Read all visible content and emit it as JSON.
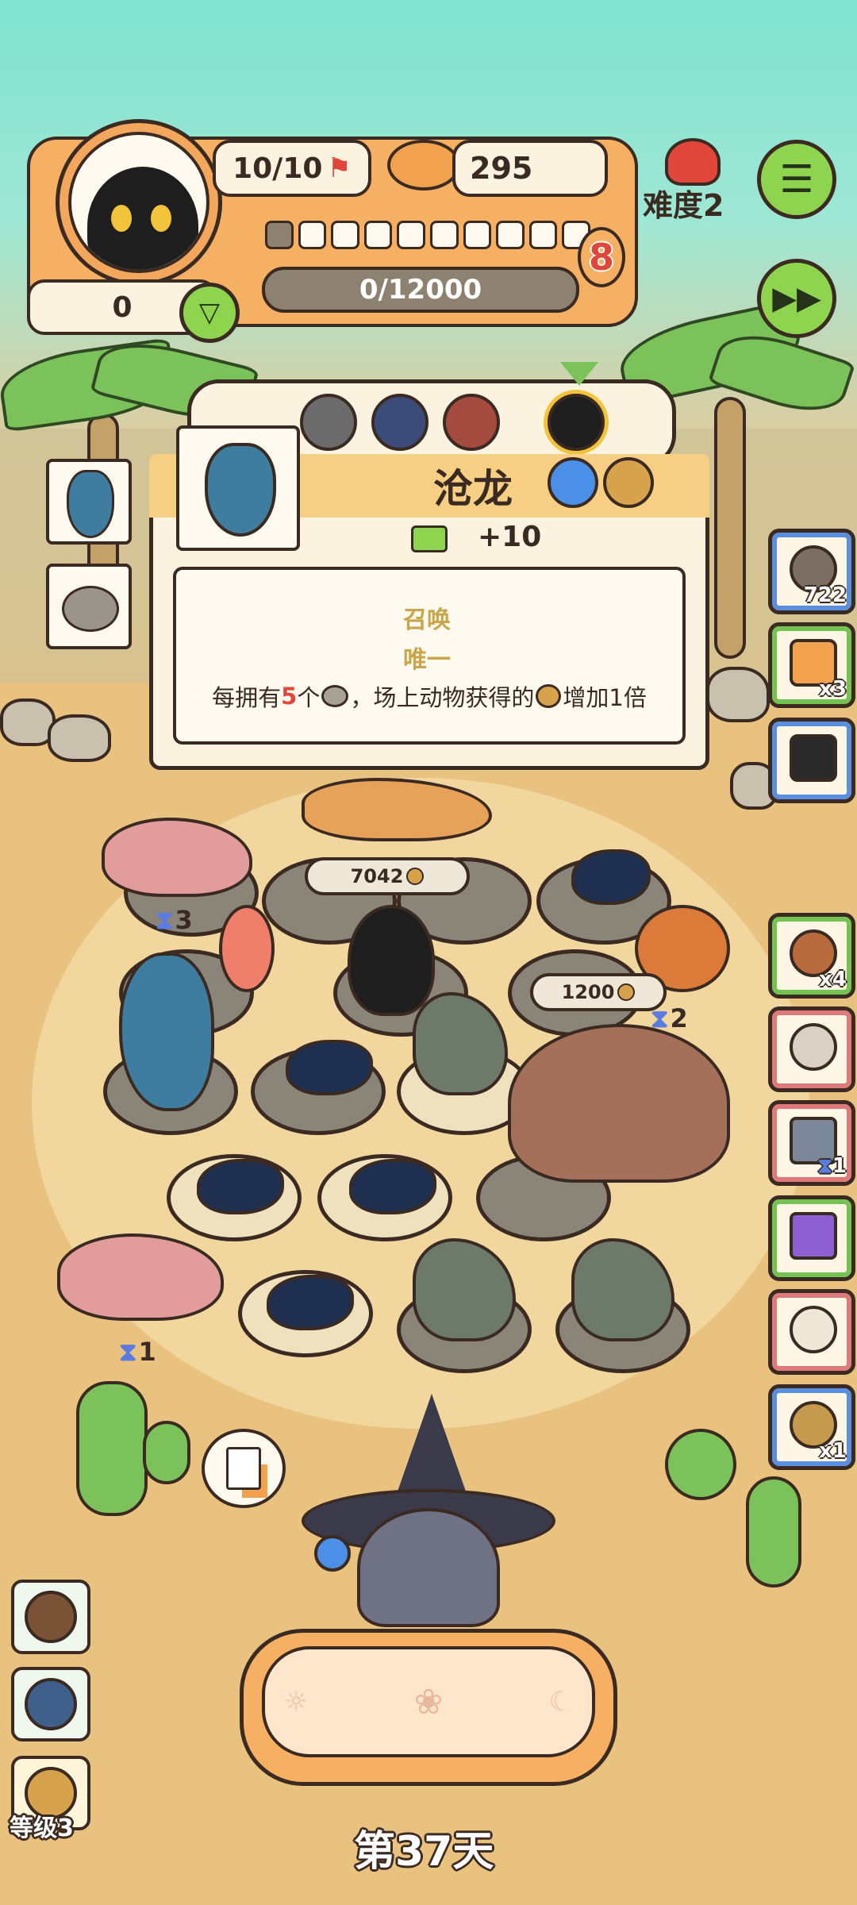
{
  "hud": {
    "population": "10/10",
    "coins": "295",
    "progress_text": "0/12000",
    "level_badge": "8",
    "left_counter": "0",
    "difficulty": "难度2",
    "progress_segments_total": 10,
    "progress_segments_filled": 0
  },
  "popup": {
    "title": "沧龙",
    "reward": "+10",
    "line1": "召唤",
    "line2": "唯一",
    "effect_prefix": "每拥有",
    "effect_number": "5",
    "effect_middle": "个",
    "effect_suffix": "，场上动物获得的",
    "effect_end": "增加1倍"
  },
  "board": {
    "price_tags": [
      "7042",
      "1200"
    ],
    "timers": [
      "3",
      "2",
      "1"
    ]
  },
  "side_items": [
    {
      "name": "film-reel",
      "count": "722"
    },
    {
      "name": "ticket",
      "count": "x3"
    },
    {
      "name": "camera",
      "count": ""
    },
    {
      "name": "turtle",
      "count": "x4"
    },
    {
      "name": "scissors",
      "count": ""
    },
    {
      "name": "guitar-card",
      "count": "1"
    },
    {
      "name": "bank-card",
      "count": ""
    },
    {
      "name": "skeleton",
      "count": ""
    },
    {
      "name": "magpie-nest",
      "count": "x1"
    }
  ],
  "bottom": {
    "level": "等级3",
    "day": "第37天"
  },
  "colors": {
    "accent_orange": "#f6b063",
    "accent_green": "#8fd44f",
    "outline": "#3a2a22",
    "highlight_red": "#e0463a"
  }
}
